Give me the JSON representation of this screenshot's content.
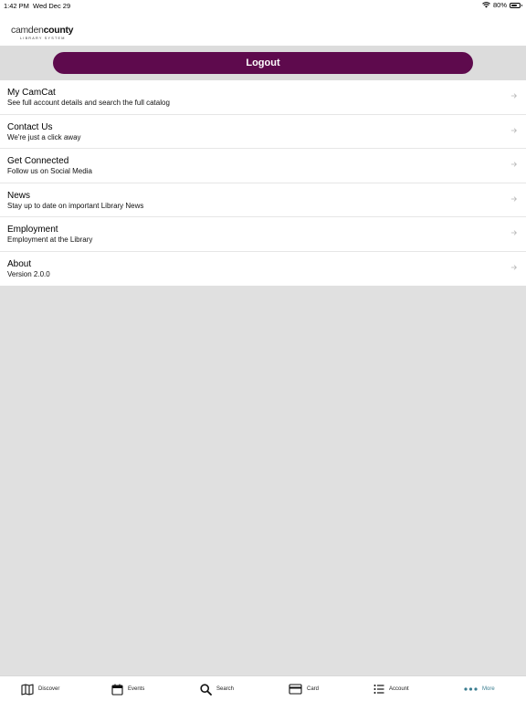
{
  "status_bar": {
    "time": "1:42 PM",
    "date": "Wed Dec 29",
    "battery": "80%",
    "battery_level": 0.8
  },
  "header": {
    "logo_text_light": "camden",
    "logo_text_bold": "county",
    "logo_subtext": "LIBRARY SYSTEM"
  },
  "logout_label": "Logout",
  "menu": [
    {
      "title": "My CamCat",
      "subtitle": "See full account details and search the full catalog"
    },
    {
      "title": "Contact Us",
      "subtitle": "We're just a click away"
    },
    {
      "title": "Get Connected",
      "subtitle": "Follow us on Social Media"
    },
    {
      "title": "News",
      "subtitle": "Stay up to date on important Library News"
    },
    {
      "title": "Employment",
      "subtitle": "Employment at the Library"
    },
    {
      "title": "About",
      "subtitle": "Version 2.0.0"
    }
  ],
  "tabs": [
    {
      "label": "Discover",
      "icon": "map-icon"
    },
    {
      "label": "Events",
      "icon": "calendar-icon"
    },
    {
      "label": "Search",
      "icon": "search-icon"
    },
    {
      "label": "Card",
      "icon": "card-icon"
    },
    {
      "label": "Account",
      "icon": "list-icon"
    },
    {
      "label": "More",
      "icon": "more-icon",
      "active": true
    }
  ],
  "colors": {
    "accent": "#5e0a4d",
    "active_tab": "#3a7d90",
    "background": "#e0e0e0"
  }
}
